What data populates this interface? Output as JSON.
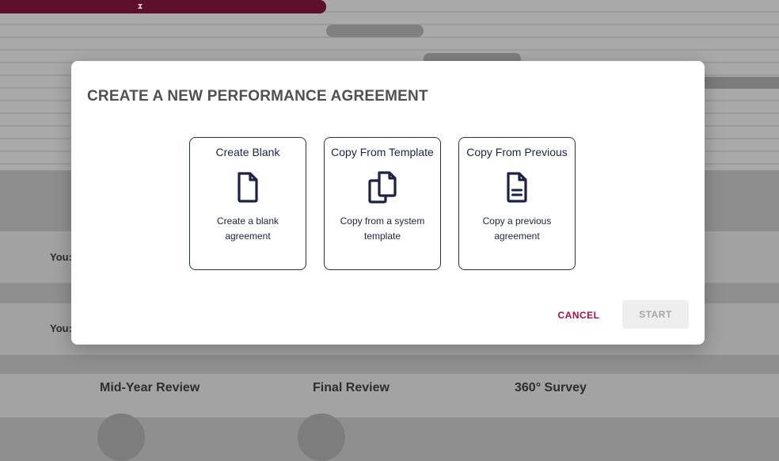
{
  "background": {
    "you_label_1": "You:",
    "you_label_2": "You:",
    "sections": [
      "Mid-Year Review",
      "Final Review",
      "360° Survey"
    ]
  },
  "modal": {
    "title": "CREATE A NEW PERFORMANCE AGREEMENT",
    "options": [
      {
        "title": "Create Blank",
        "description": "Create a blank agreement",
        "icon": "blank-document-icon"
      },
      {
        "title": "Copy From Template",
        "description": "Copy from a system template",
        "icon": "copy-documents-icon"
      },
      {
        "title": "Copy From Previous",
        "description": "Copy a previous agreement",
        "icon": "text-document-icon"
      }
    ],
    "cancel_label": "CANCEL",
    "start_label": "START"
  },
  "colors": {
    "accent": "#a5104d",
    "progress": "#5e0f2c",
    "card_border": "#2a2f4a",
    "icon": "#1d2244"
  }
}
